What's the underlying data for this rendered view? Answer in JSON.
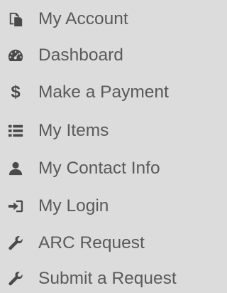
{
  "menu": {
    "items": [
      {
        "label": "My Account",
        "icon": "copy-icon"
      },
      {
        "label": "Dashboard",
        "icon": "dashboard-icon"
      },
      {
        "label": "Make a Payment",
        "icon": "dollar-icon",
        "glyph": "$"
      },
      {
        "label": "My Items",
        "icon": "list-icon"
      },
      {
        "label": "My Contact Info",
        "icon": "user-icon"
      },
      {
        "label": "My Login",
        "icon": "sign-in-icon"
      },
      {
        "label": "ARC Request",
        "icon": "wrench-icon"
      },
      {
        "label": "Submit a Request",
        "icon": "wrench-icon"
      }
    ]
  }
}
